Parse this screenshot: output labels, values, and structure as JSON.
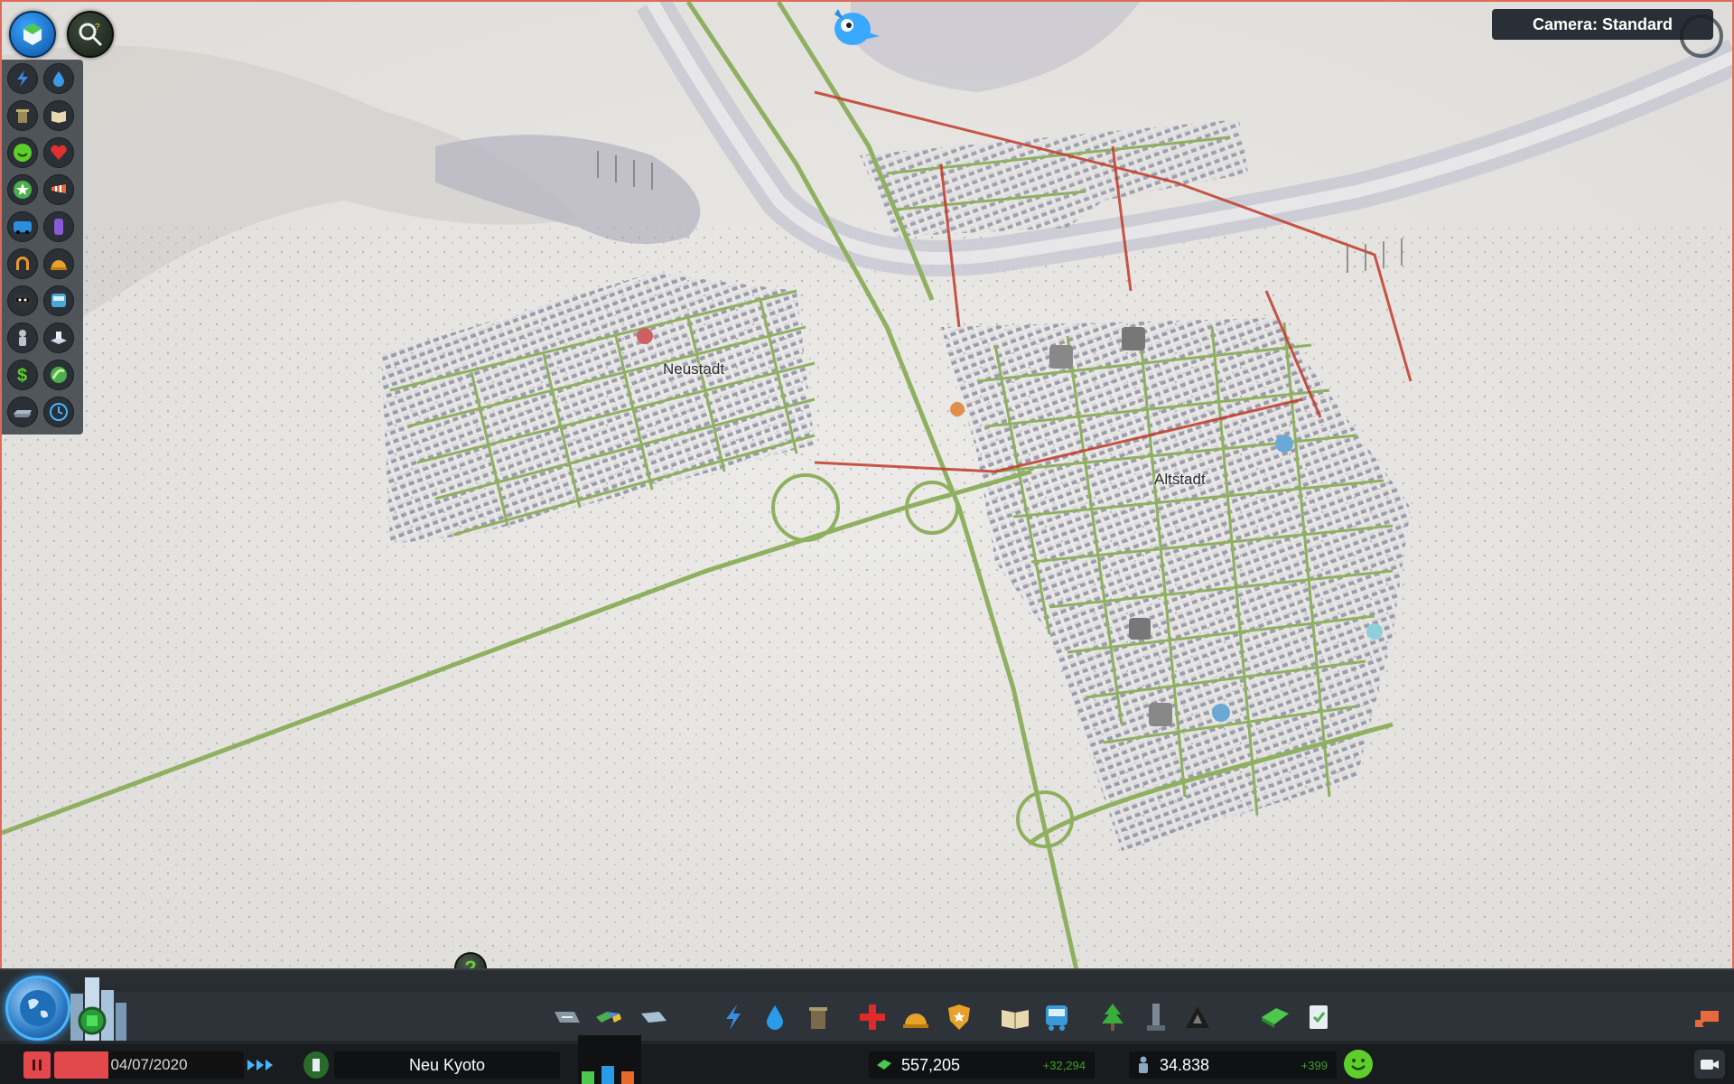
{
  "camera": {
    "label": "Camera: Standard"
  },
  "districts": [
    {
      "name": "Neustadt"
    },
    {
      "name": "Altstadt"
    }
  ],
  "status": {
    "date": "04/07/2020",
    "city_name": "Neu Kyoto",
    "money": "557,205",
    "money_delta": "+32,294",
    "population": "34.838",
    "population_delta": "+399"
  },
  "help": {
    "label": "?"
  },
  "icons": {
    "top_left": [
      "unlock-icon",
      "info-search-icon"
    ],
    "info_views": [
      "electricity-icon",
      "water-icon",
      "garbage-icon",
      "education-icon",
      "happiness-icon",
      "health-icon",
      "level-icon",
      "wind-icon",
      "traffic-icon",
      "noise-icon",
      "fire-icon",
      "crime-icon",
      "public-transport-icon",
      "population-icon",
      "land-value-icon",
      "money-icon",
      "natural-resources-icon",
      "outside-connections-icon",
      "time-icon"
    ],
    "toolbar": [
      "roads-icon",
      "zoning-icon",
      "districts-icon",
      "electricity-icon",
      "water-icon",
      "garbage-icon",
      "healthcare-icon",
      "fire-icon",
      "police-icon",
      "education-icon",
      "transport-icon",
      "parks-icon",
      "monuments-icon",
      "landscaping-icon",
      "economy-icon",
      "policies-icon",
      "bulldozer-icon"
    ]
  },
  "colors": {
    "accent_red": "#e2484c",
    "money_green": "#3f9f2a",
    "road_green": "#8fb060",
    "road_red": "#c23a2a"
  }
}
